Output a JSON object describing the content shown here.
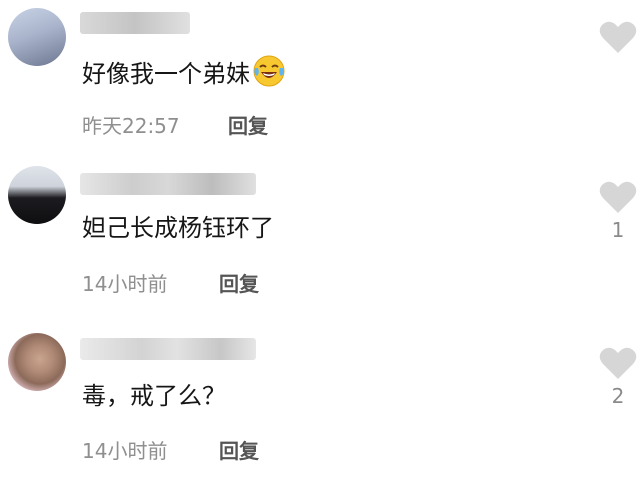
{
  "comments": [
    {
      "content": "好像我一个弟妹",
      "emoji": "face-with-tears-of-joy-emoji",
      "time": "昨天22:57",
      "reply_label": "回复",
      "like_count": ""
    },
    {
      "content": "妲己长成杨钰环了",
      "time": "14小时前",
      "reply_label": "回复",
      "like_count": "1"
    },
    {
      "content": "毒，戒了么？",
      "time": "14小时前",
      "reply_label": "回复",
      "like_count": "2"
    }
  ],
  "icons": {
    "like": "heart-icon"
  },
  "colors": {
    "heart": "#d6d6d6",
    "meta_text": "#8f8f8f",
    "reply_text": "#555555"
  }
}
